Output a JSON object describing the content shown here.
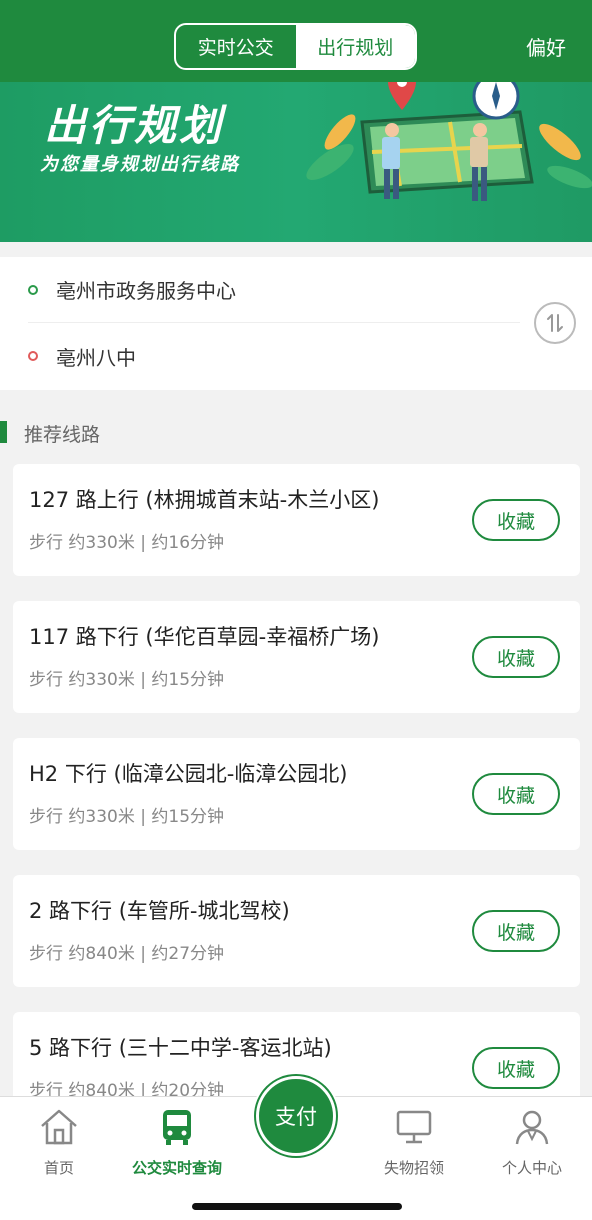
{
  "header": {
    "tabs": [
      {
        "label": "实时公交",
        "active": false
      },
      {
        "label": "出行规划",
        "active": true
      }
    ],
    "preference_label": "偏好",
    "accent_color": "#1f8a3e"
  },
  "banner": {
    "title": "出行规划",
    "subtitle": "为您量身规划出行线路"
  },
  "route": {
    "from": "亳州市政务服务中心",
    "to": "亳州八中",
    "swap_icon": "swap-vertical-icon"
  },
  "section": {
    "title": "推荐线路"
  },
  "routes": [
    {
      "name": "127 路上行 (林拥城首末站-木兰小区)",
      "meta": "步行 约330米 | 约16分钟",
      "fav_label": "收藏"
    },
    {
      "name": "117 路下行 (华佗百草园-幸福桥广场)",
      "meta": "步行 约330米 | 约15分钟",
      "fav_label": "收藏"
    },
    {
      "name": "H2 下行 (临漳公园北-临漳公园北)",
      "meta": "步行 约330米 | 约15分钟",
      "fav_label": "收藏"
    },
    {
      "name": "2 路下行 (车管所-城北驾校)",
      "meta": "步行 约840米 | 约27分钟",
      "fav_label": "收藏"
    },
    {
      "name": "5 路下行 (三十二中学-客运北站)",
      "meta": "步行 约840米 | 约20分钟",
      "fav_label": "收藏"
    }
  ],
  "tabbar": {
    "items": [
      {
        "label": "首页",
        "icon": "home-icon",
        "active": false
      },
      {
        "label": "公交实时查询",
        "icon": "bus-icon",
        "active": true
      },
      {
        "label": "失物招领",
        "icon": "monitor-icon",
        "active": false
      },
      {
        "label": "个人中心",
        "icon": "person-icon",
        "active": false
      }
    ],
    "pay_label": "支付"
  }
}
